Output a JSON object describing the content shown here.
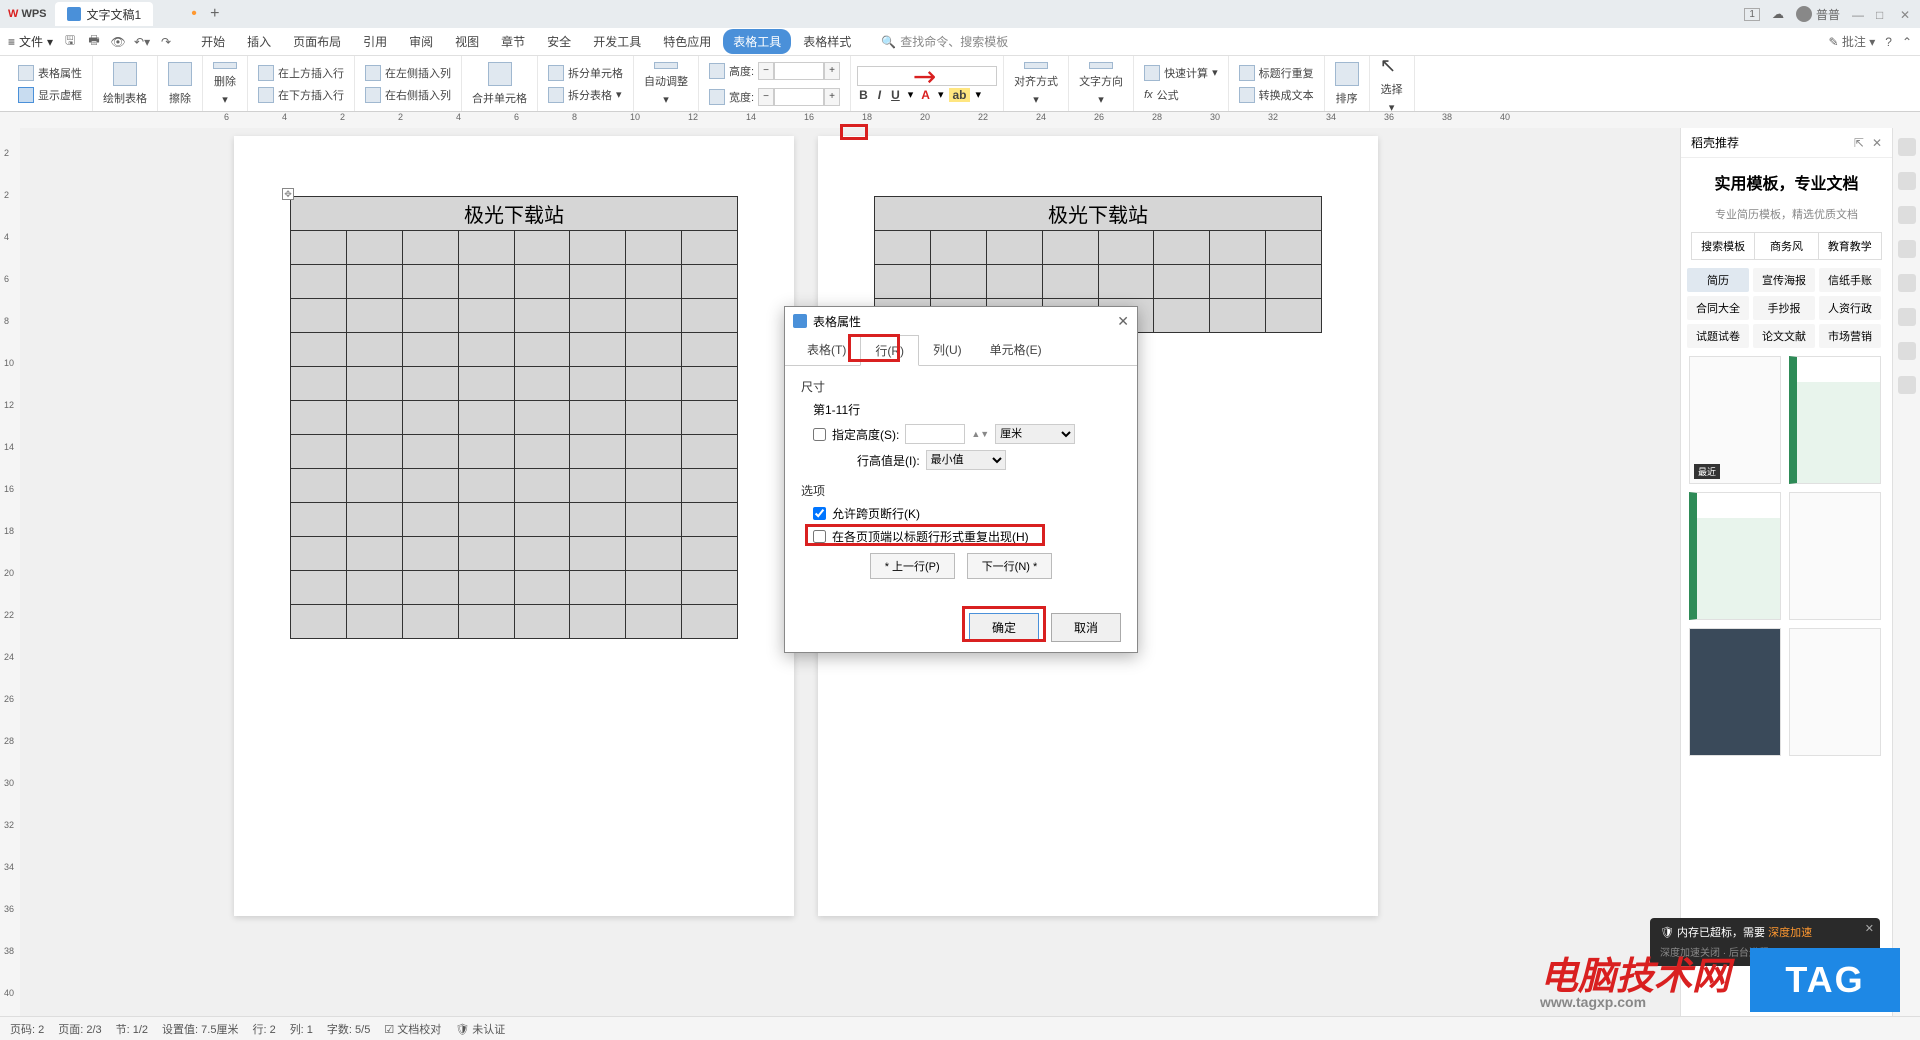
{
  "titlebar": {
    "app": "WPS",
    "tab1": "文字文稿1",
    "user": "普普",
    "badge": "1"
  },
  "menu": {
    "file": "文件",
    "tabs": [
      "开始",
      "插入",
      "页面布局",
      "引用",
      "审阅",
      "视图",
      "章节",
      "安全",
      "开发工具",
      "特色应用",
      "表格工具",
      "表格样式"
    ],
    "activeIndex": 10,
    "search": "查找命令、搜索模板",
    "approve": "批注"
  },
  "ribbon": {
    "props": "表格属性",
    "showFrame": "显示虚框",
    "drawTable": "绘制表格",
    "erase": "擦除",
    "delete": "删除",
    "insAbove": "在上方插入行",
    "insBelow": "在下方插入行",
    "insLeft": "在左侧插入列",
    "insRight": "在右侧插入列",
    "merge": "合并单元格",
    "splitCell": "拆分单元格",
    "splitTable": "拆分表格",
    "autoFit": "自动调整",
    "height": "高度:",
    "width": "宽度:",
    "align": "对齐方式",
    "textDir": "文字方向",
    "fastCalc": "快速计算",
    "formula": "公式",
    "headerRepeat": "标题行重复",
    "toText": "转换成文本",
    "sort": "排序",
    "select": "选择"
  },
  "ruler_h": [
    "6",
    "4",
    "2",
    "2",
    "4",
    "6",
    "8",
    "10",
    "12",
    "14",
    "16",
    "18",
    "20",
    "22",
    "24",
    "26",
    "28",
    "30",
    "32",
    "34",
    "36",
    "38",
    "40"
  ],
  "ruler_v": [
    "2",
    "2",
    "4",
    "6",
    "8",
    "10",
    "12",
    "14",
    "16",
    "18",
    "20",
    "22",
    "24",
    "26",
    "28",
    "30",
    "32",
    "34",
    "36",
    "38",
    "40"
  ],
  "page": {
    "tableTitle": "极光下载站"
  },
  "dialog": {
    "title": "表格属性",
    "tabs": {
      "t": "表格(T)",
      "r": "行(R)",
      "u": "列(U)",
      "e": "单元格(E)"
    },
    "sizeSection": "尺寸",
    "rowRange": "第1-11行",
    "specHeight": "指定高度(S):",
    "unit": "厘米",
    "rowHeightIs": "行高值是(I):",
    "minVal": "最小值",
    "optSection": "选项",
    "allowBreak": "允许跨页断行(K)",
    "repeatHeader": "在各页顶端以标题行形式重复出现(H)",
    "prevRow": "* 上一行(P)",
    "nextRow": "下一行(N) *",
    "ok": "确定",
    "cancel": "取消"
  },
  "rightPanel": {
    "header": "稻壳推荐",
    "title": "实用模板，专业文档",
    "subtitle": "专业简历模板，精选优质文档",
    "tabs": [
      "搜索模板",
      "商务风",
      "教育教学"
    ],
    "cats": [
      "简历",
      "宣传海报",
      "信纸手账",
      "合同大全",
      "手抄报",
      "人资行政",
      "试题试卷",
      "论文文献",
      "市场营销"
    ],
    "recent": "最近"
  },
  "status": {
    "pageNum": "页码: 2",
    "page": "页面: 2/3",
    "section": "节: 1/2",
    "pos": "设置值: 7.5厘米",
    "row": "行: 2",
    "col": "列: 1",
    "words": "字数: 5/5",
    "docCheck": "文档校对",
    "unauth": "未认证"
  },
  "notif": {
    "text1": "内存已超标，需要",
    "text2": "深度加速",
    "sub": "深度加速关闭  · 后台进程"
  },
  "watermark": {
    "main": "电脑技术网",
    "url": "www.tagxp.com",
    "tag": "TAG"
  }
}
